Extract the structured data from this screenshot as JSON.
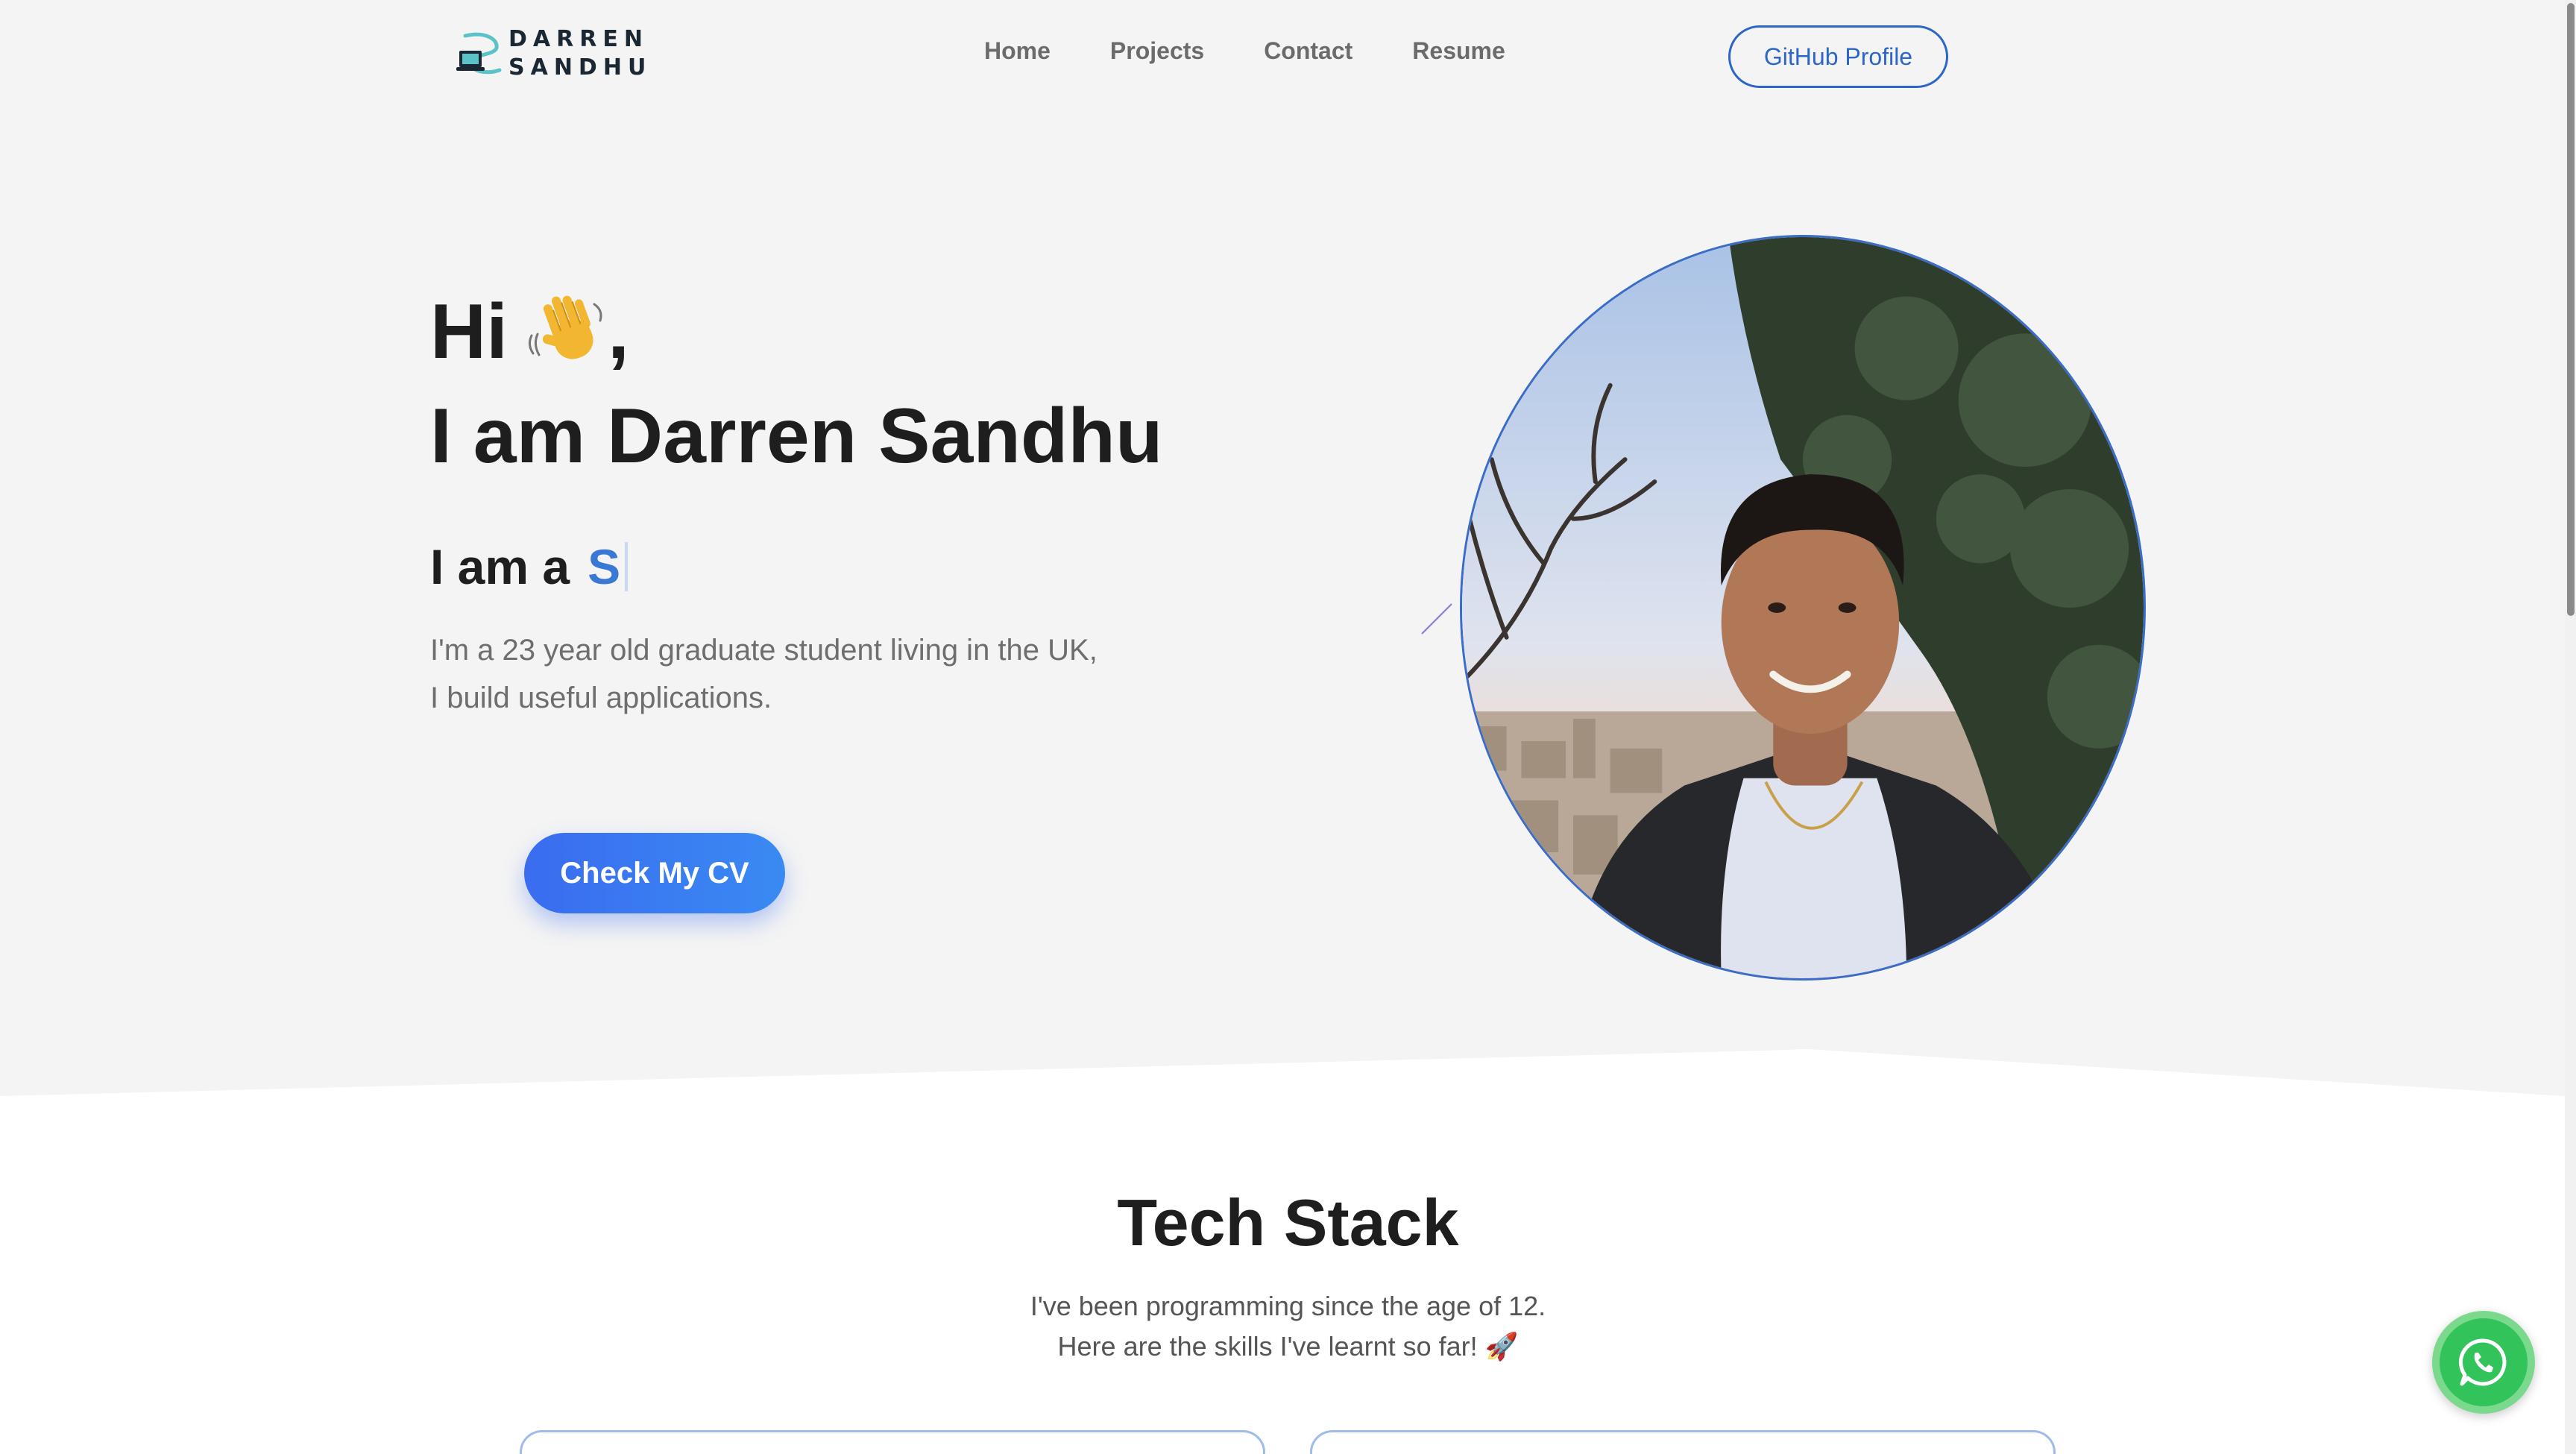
{
  "header": {
    "logo_line1": "DARREN",
    "logo_line2": "SANDHU",
    "nav": [
      "Home",
      "Projects",
      "Contact",
      "Resume"
    ],
    "github_label": "GitHub Profile"
  },
  "hero": {
    "greeting": "Hi",
    "greeting_suffix": ",",
    "name_line": "I am Darren Sandhu",
    "role_prefix": "I am a",
    "role_typed": "S",
    "description_line1": "I'm a 23 year old graduate student living in the UK,",
    "description_line2": "I build useful applications.",
    "cta_label": "Check My CV",
    "wave_icon": "waving-hand-icon"
  },
  "tech_stack": {
    "title": "Tech Stack",
    "subtitle_line1": "I've been programming since the age of 12.",
    "subtitle_line2": "Here are the skills I've learnt so far! 🚀"
  },
  "colors": {
    "accent": "#3a78d6",
    "cta_start": "#3a6cf0",
    "cta_end": "#3a8af2",
    "page_bg": "#f4f4f4",
    "whatsapp": "#32c35a"
  },
  "floating": {
    "whatsapp_icon": "whatsapp-icon"
  }
}
